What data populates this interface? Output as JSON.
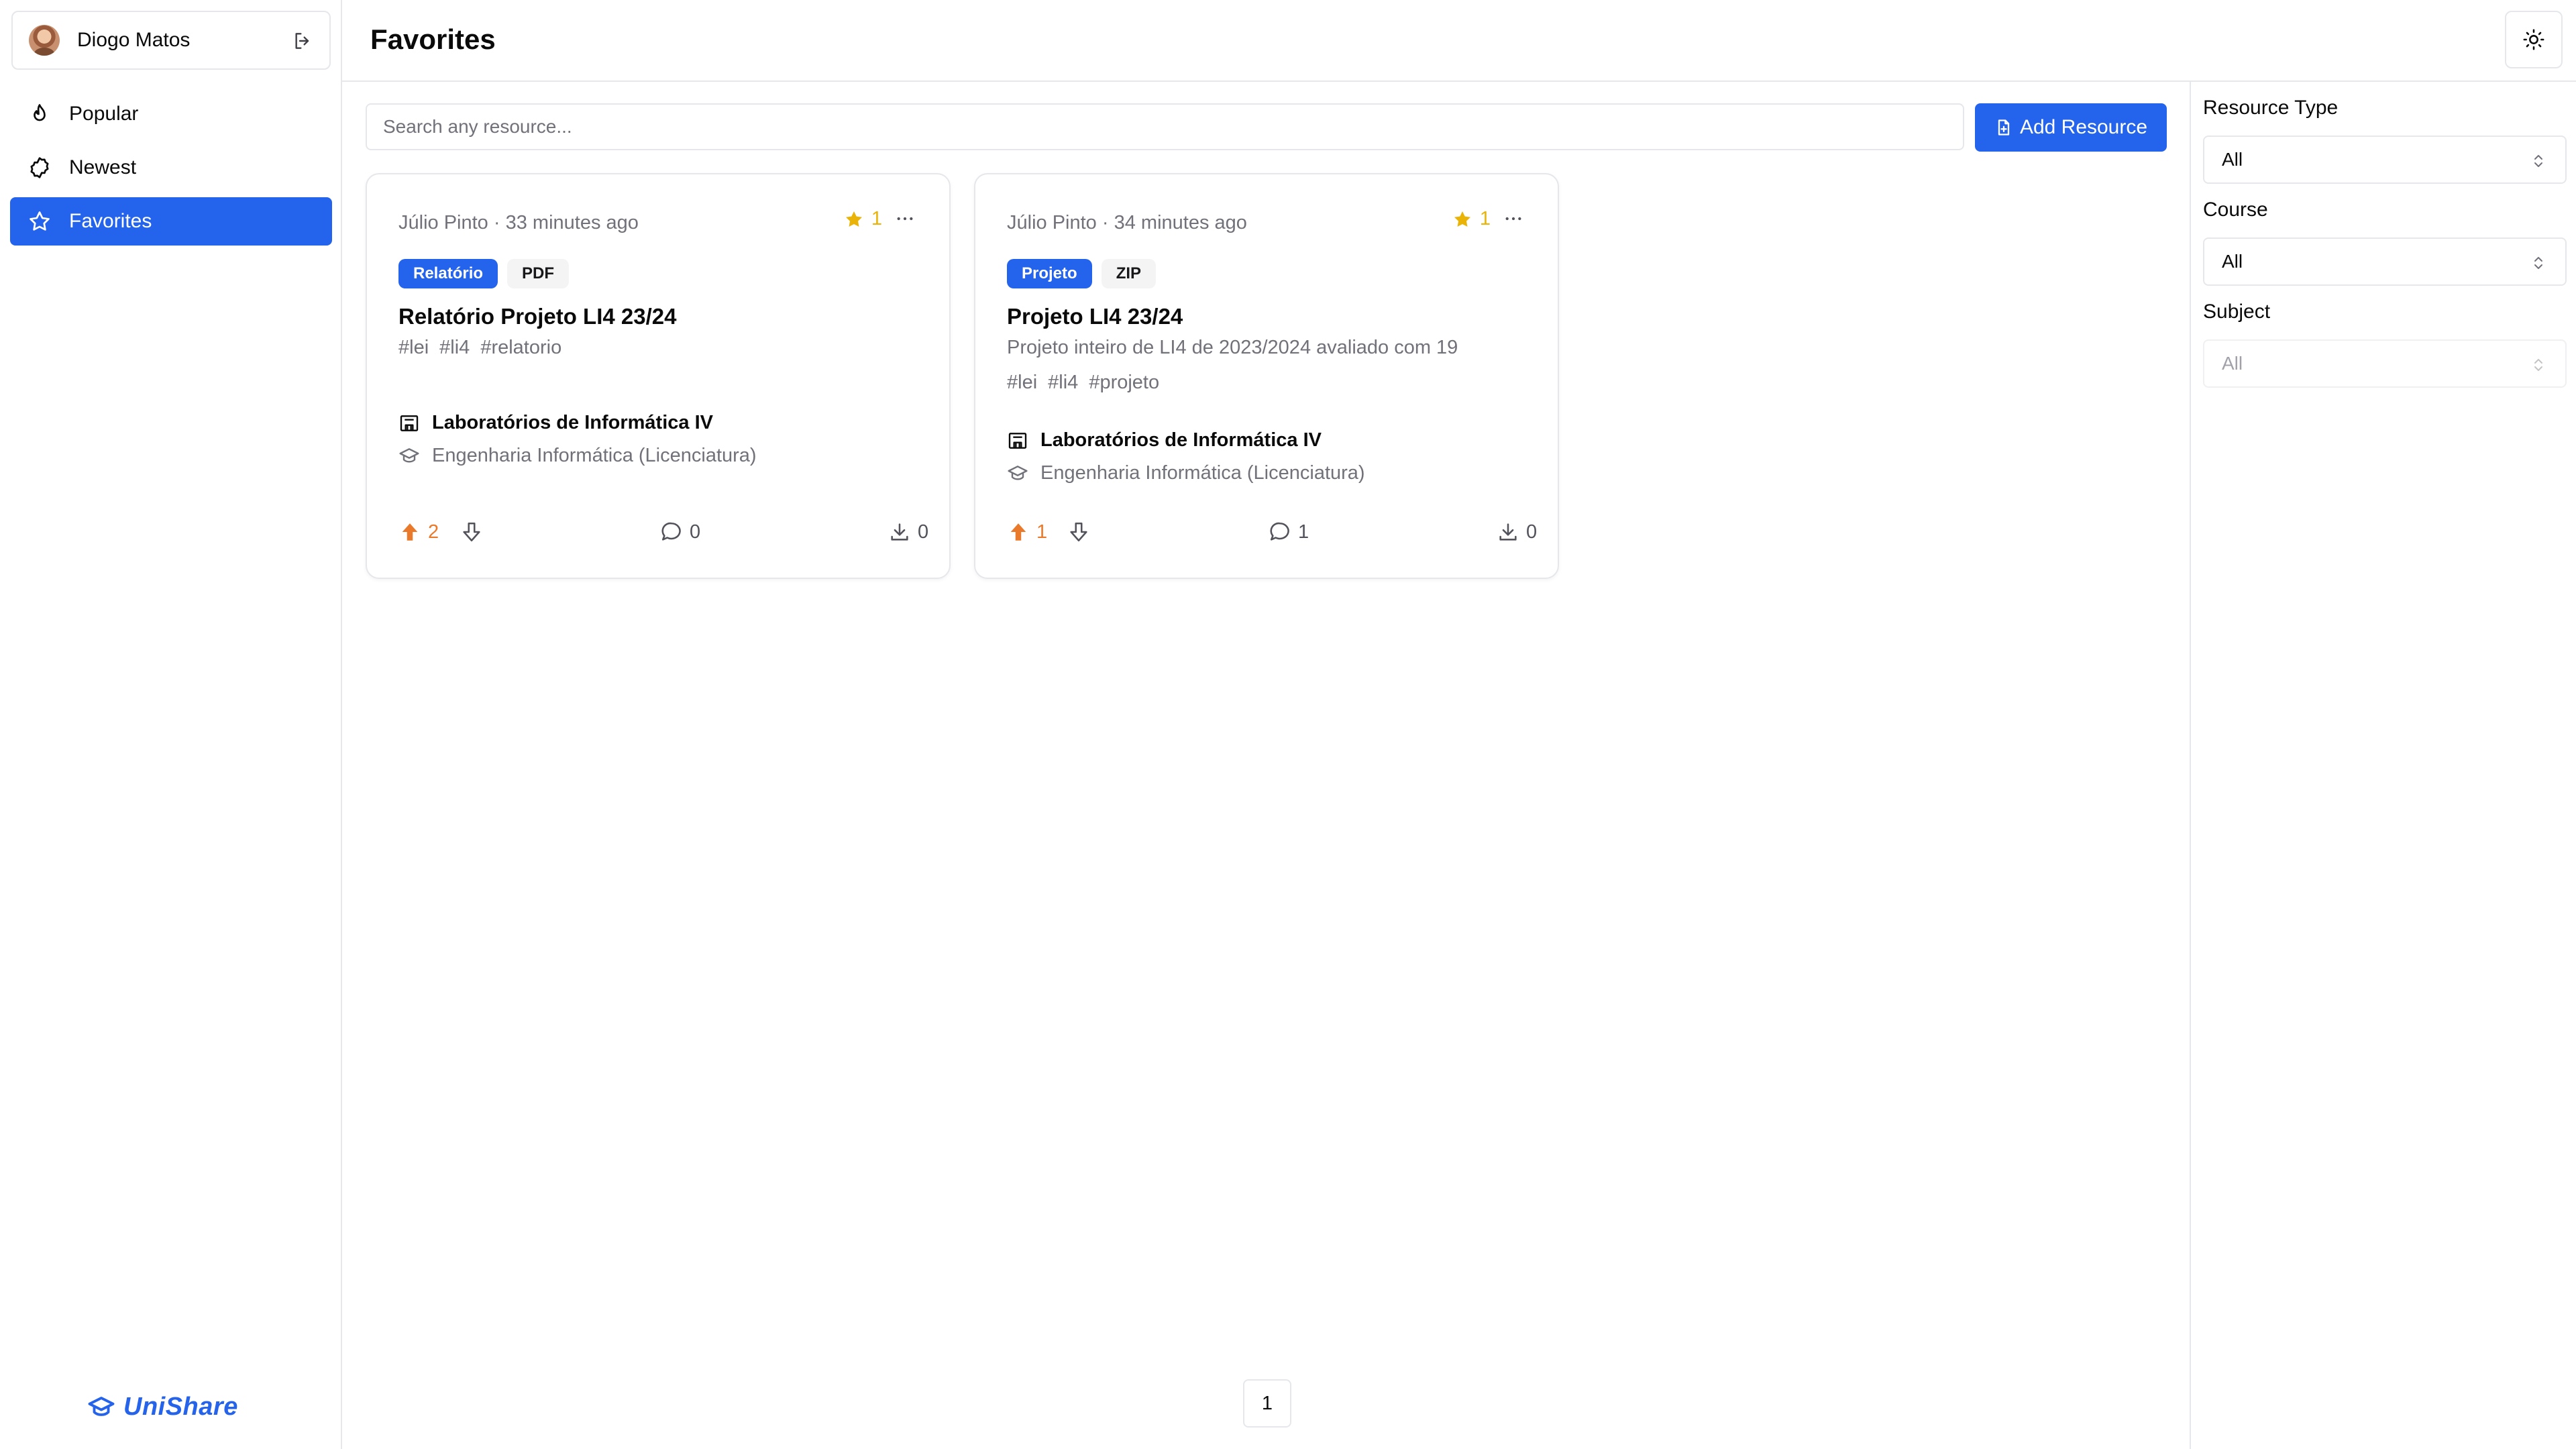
{
  "user": {
    "name": "Diogo Matos"
  },
  "nav": [
    {
      "label": "Popular",
      "icon": "flame-icon"
    },
    {
      "label": "Newest",
      "icon": "badge-icon"
    },
    {
      "label": "Favorites",
      "icon": "star-icon"
    }
  ],
  "brand": {
    "name": "UniShare"
  },
  "header": {
    "title": "Favorites"
  },
  "search": {
    "placeholder": "Search any resource..."
  },
  "toolbar": {
    "add_label": "Add Resource"
  },
  "cards": [
    {
      "author": "Júlio Pinto",
      "time": "33 minutes ago",
      "favorites": "1",
      "tags": [
        "Relatório",
        "PDF"
      ],
      "title": "Relatório Projeto LI4 23/24",
      "description": "",
      "hashtags": [
        "#lei",
        "#li4",
        "#relatorio"
      ],
      "subject": "Laboratórios de Informática IV",
      "course": "Engenharia Informática (Licenciatura)",
      "upvotes": "2",
      "comments": "0",
      "downloads": "0"
    },
    {
      "author": "Júlio Pinto",
      "time": "34 minutes ago",
      "favorites": "1",
      "tags": [
        "Projeto",
        "ZIP"
      ],
      "title": "Projeto LI4 23/24",
      "description": "Projeto inteiro de LI4 de 2023/2024 avaliado com 19",
      "hashtags": [
        "#lei",
        "#li4",
        "#projeto"
      ],
      "subject": "Laboratórios de Informática IV",
      "course": "Engenharia Informática (Licenciatura)",
      "upvotes": "1",
      "comments": "1",
      "downloads": "0"
    }
  ],
  "pagination": {
    "current": "1"
  },
  "filters": {
    "resource_type": {
      "label": "Resource Type",
      "value": "All"
    },
    "course": {
      "label": "Course",
      "value": "All"
    },
    "subject": {
      "label": "Subject",
      "value": "All"
    }
  },
  "colors": {
    "primary": "#2463eb",
    "star": "#eab308",
    "upvote": "#ea7a2b",
    "muted": "#71717a",
    "border": "#e5e7eb"
  }
}
